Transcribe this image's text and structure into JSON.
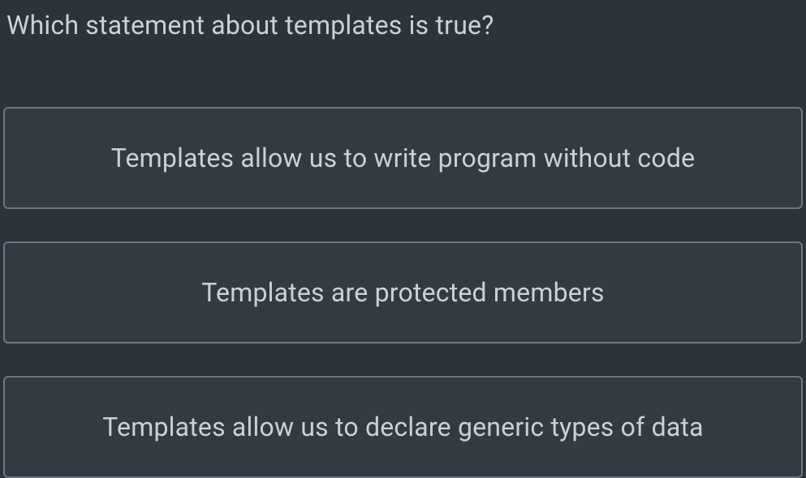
{
  "question": {
    "text": "Which statement about templates is true?"
  },
  "options": [
    {
      "label": "Templates allow us to write program without code"
    },
    {
      "label": "Templates are protected members"
    },
    {
      "label": "Templates allow us to declare generic types of data"
    }
  ]
}
